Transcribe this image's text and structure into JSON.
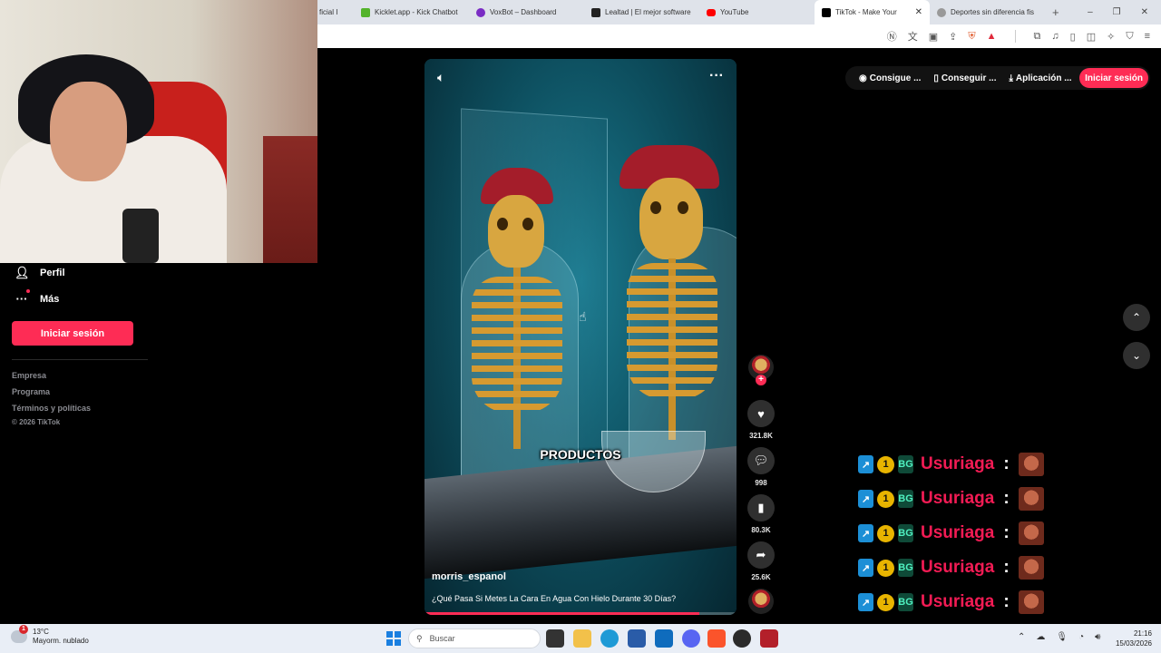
{
  "browser": {
    "tabs": [
      {
        "label": "ficial I",
        "color": "#888888"
      },
      {
        "label": "Kicklet.app - Kick Chatbot",
        "color": "#53b32b"
      },
      {
        "label": "VoxBot – Dashboard",
        "color": "#7a2cc4"
      },
      {
        "label": "Lealtad | El mejor software",
        "color": "#222222"
      },
      {
        "label": "YouTube",
        "color": "#ff0000"
      },
      {
        "label": "TikTok - Make Your",
        "color": "#000000",
        "active": true
      },
      {
        "label": "Deportes sin diferencia fis",
        "color": "#777777"
      }
    ],
    "new_tab": "+",
    "window_controls": [
      "–",
      "❐",
      "✕"
    ]
  },
  "sidebar": {
    "items": [
      {
        "label": "Perfil",
        "icon": "person-icon"
      },
      {
        "label": "Más",
        "icon": "more-icon"
      }
    ],
    "login_label": "Iniciar sesión",
    "footer_links": [
      "Empresa",
      "Programa",
      "Términos y políticas"
    ],
    "copyright": "© 2026 TikTok"
  },
  "header": {
    "items": [
      {
        "label": "Consigue ...",
        "icon": "coin-icon"
      },
      {
        "label": "Conseguir ...",
        "icon": "phone-icon"
      },
      {
        "label": "Aplicación ...",
        "icon": "download-icon"
      }
    ],
    "login_label": "Iniciar sesión"
  },
  "video": {
    "caption_overlay": "PRODUCTOS",
    "author": "morris_espanol",
    "description": "¿Qué Pasa Si Metes La Cara En Agua Con Hielo Durante 30 Días?",
    "progress": 0.88
  },
  "actions": {
    "likes": "321.8K",
    "comments": "998",
    "saves": "80.3K",
    "shares": "25.6K"
  },
  "chat": {
    "rows": [
      {
        "name": "Usuriaga",
        "sep": ":"
      },
      {
        "name": "Usuriaga",
        "sep": ":"
      },
      {
        "name": "Usuriaga",
        "sep": ":"
      },
      {
        "name": "Usuriaga",
        "sep": ":"
      },
      {
        "name": "Usuriaga",
        "sep": ":"
      }
    ],
    "badges": [
      "↗",
      "1",
      "BG"
    ]
  },
  "taskbar": {
    "weather_badge": "1",
    "temperature": "13°C",
    "weather_desc": "Mayorm. nublado",
    "search_placeholder": "Buscar",
    "time": "21:16",
    "date": "15/03/2026"
  },
  "colors": {
    "accent": "#fe2c55",
    "chat_name": "#f21b54"
  }
}
